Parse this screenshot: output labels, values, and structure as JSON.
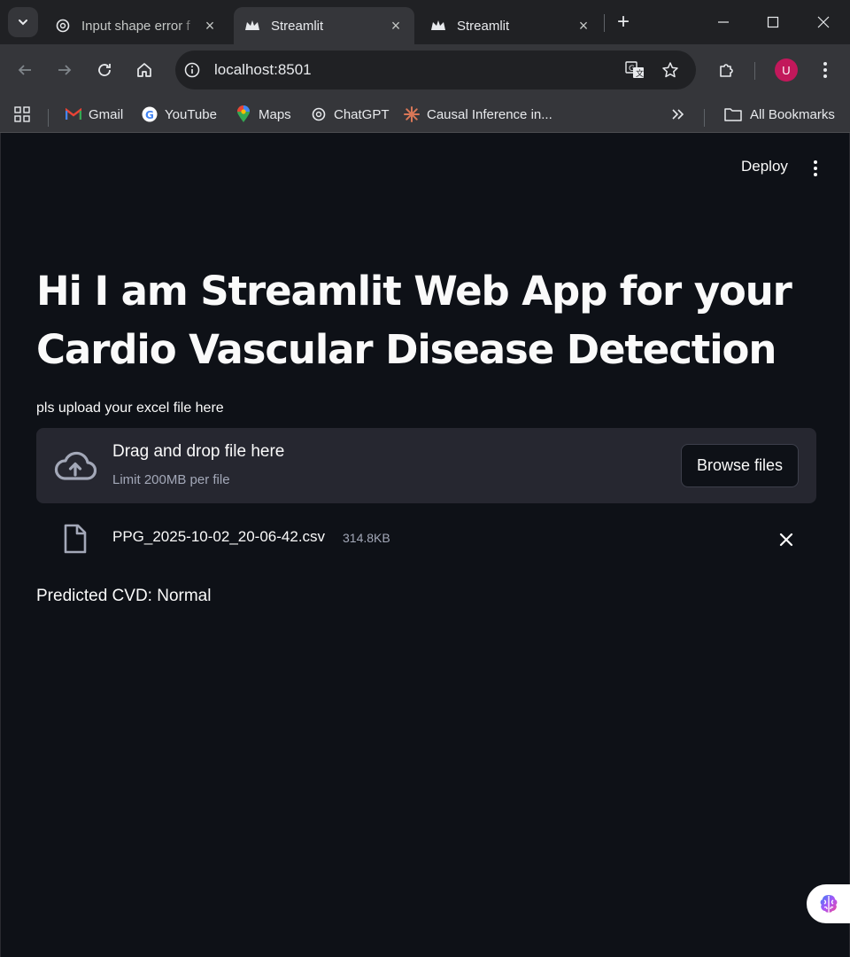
{
  "browser": {
    "tabs": [
      {
        "title": "Input shape error f",
        "icon": "chatgpt-icon",
        "active": false
      },
      {
        "title": "Streamlit",
        "icon": "streamlit-crown-icon",
        "active": true
      },
      {
        "title": "Streamlit",
        "icon": "streamlit-crown-icon",
        "active": false
      }
    ],
    "address": "localhost:8501",
    "avatar_letter": "U",
    "avatar_color": "#c2185b",
    "bookmarks": [
      {
        "label": "Gmail",
        "icon": "gmail-icon"
      },
      {
        "label": "YouTube",
        "icon": "google-icon"
      },
      {
        "label": "Maps",
        "icon": "maps-pin-icon"
      },
      {
        "label": "ChatGPT",
        "icon": "chatgpt-icon"
      },
      {
        "label": "Causal Inference in...",
        "icon": "claude-sparkle-icon"
      }
    ],
    "all_bookmarks": "All Bookmarks"
  },
  "app": {
    "deploy_label": "Deploy",
    "title": "Hi I am Streamlit Web App for your Cardio Vascular Disease Detection",
    "uploader": {
      "label": "pls upload your excel file here",
      "drag_text": "Drag and drop file here",
      "limit_text": "Limit 200MB per file",
      "browse_label": "Browse files"
    },
    "uploaded_file": {
      "name": "PPG_2025-10-02_20-06-42.csv",
      "size": "314.8KB"
    },
    "result": "Predicted CVD: Normal"
  },
  "colors": {
    "background": "#0e1117",
    "dropzone": "#262730",
    "text": "#fafafa",
    "muted": "#a3a8b8"
  }
}
